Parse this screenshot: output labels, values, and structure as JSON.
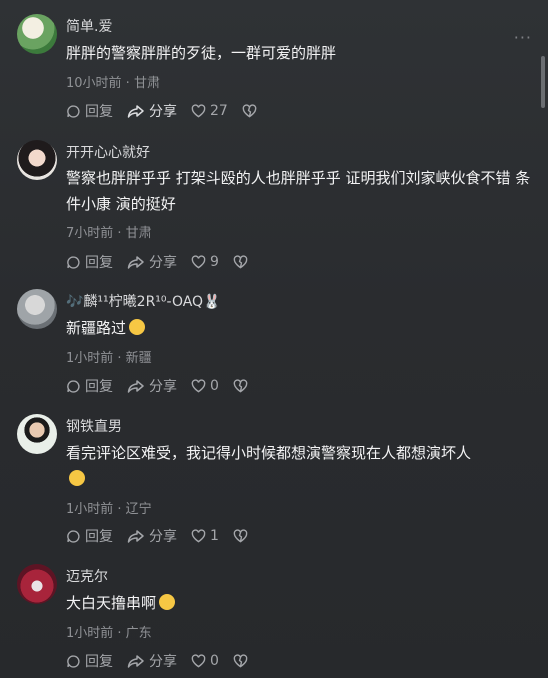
{
  "comments": [
    {
      "user": "简单.爱",
      "text": "胖胖的警察胖胖的歹徒，一群可爱的胖胖",
      "time": "10小时前 · 甘肃",
      "reply": "回复",
      "share": "分享",
      "likes": "27"
    },
    {
      "user": "开开心心就好",
      "text": "警察也胖胖乎乎 打架斗殴的人也胖胖乎乎 证明我们刘家峡伙食不错 条件小康 演的挺好",
      "time": "7小时前 · 甘肃",
      "reply": "回复",
      "share": "分享",
      "likes": "9"
    },
    {
      "user": "🎶麟¹¹柠曦2R¹⁰-OAQ🐰",
      "text": "新疆路过",
      "time": "1小时前 · 新疆",
      "reply": "回复",
      "share": "分享",
      "likes": "0"
    },
    {
      "user": "钢铁直男",
      "text": "看完评论区难受，我记得小时候都想演警察现在人都想演坏人",
      "time": "1小时前 · 辽宁",
      "reply": "回复",
      "share": "分享",
      "likes": "1"
    },
    {
      "user": "迈克尔",
      "text": "大白天撸串啊",
      "time": "1小时前 · 广东",
      "reply": "回复",
      "share": "分享",
      "likes": "0"
    }
  ],
  "more_label": "···"
}
